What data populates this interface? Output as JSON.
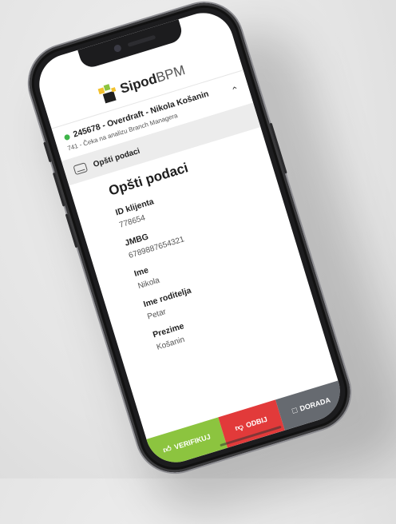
{
  "app": {
    "logo_bold": "Sipod",
    "logo_light": "BPM"
  },
  "case": {
    "title": "245678 - Overdraft - Nikola Košanin",
    "subtitle": "741 - Čeka na analizu Branch Managera",
    "status_color": "#3fb54a"
  },
  "section_tab": {
    "label": "Opšti podaci",
    "icon": "card-icon"
  },
  "content": {
    "heading": "Opšti podaci",
    "fields": [
      {
        "label": "ID klijenta",
        "value": "778654"
      },
      {
        "label": "JMBG",
        "value": "6789887654321"
      },
      {
        "label": "Ime",
        "value": "Nikola"
      },
      {
        "label": "Ime roditelja",
        "value": "Petar"
      },
      {
        "label": "Prezime",
        "value": "Košanin"
      }
    ]
  },
  "actions": {
    "verify": {
      "label": "VERIFIKUJ",
      "icon": "thumbs-up-icon",
      "color": "#8cc43f"
    },
    "reject": {
      "label": "ODBIJ",
      "icon": "thumbs-down-icon",
      "color": "#e23a3a"
    },
    "rework": {
      "label": "DORADA",
      "icon": "message-icon",
      "color": "#666a70"
    }
  }
}
